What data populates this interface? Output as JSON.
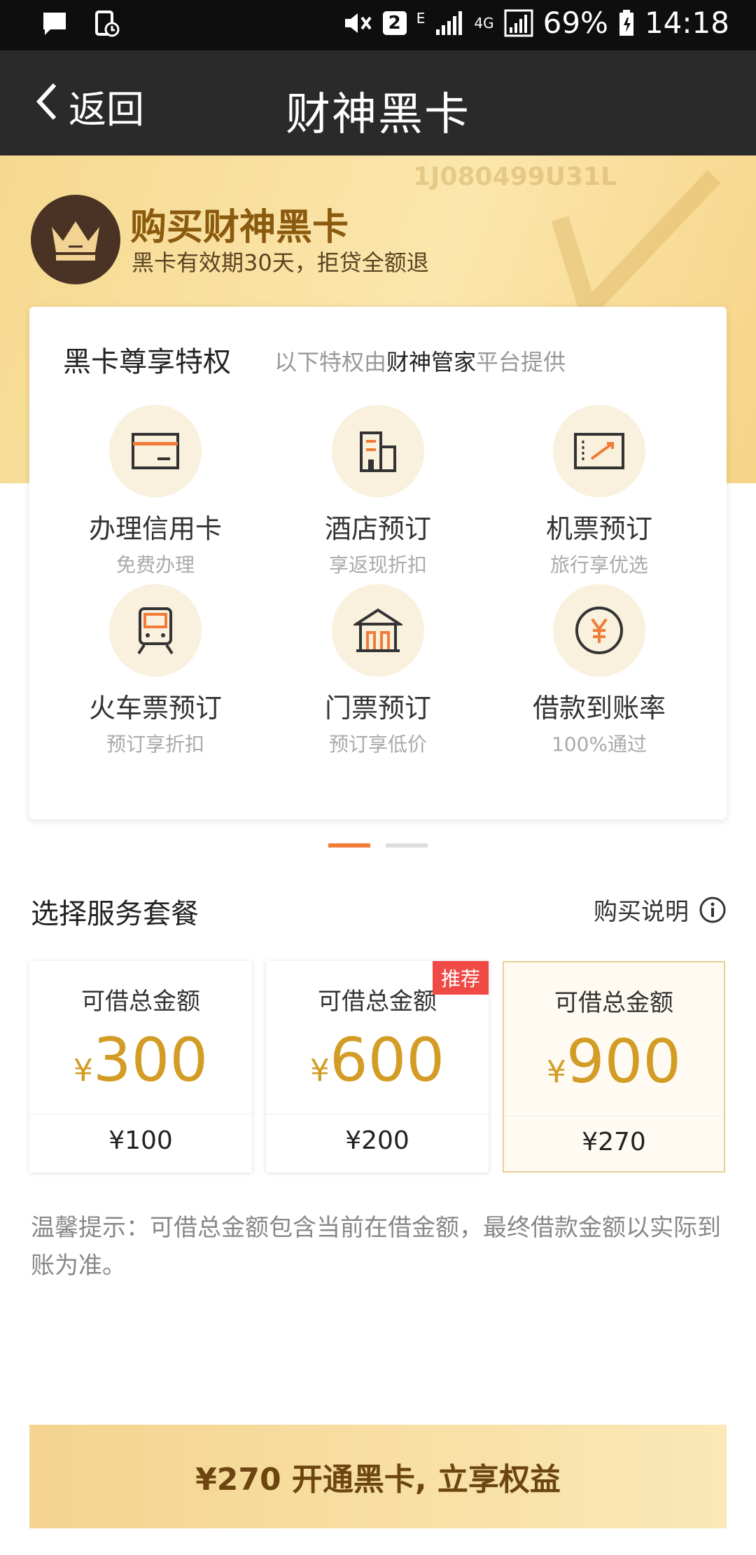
{
  "status_bar": {
    "sim_badge": "2",
    "network_e": "E",
    "network_4g": "4G",
    "battery": "69%",
    "time": "14:18"
  },
  "nav": {
    "back_label": "返回",
    "title": "财神黑卡"
  },
  "hero": {
    "watermark": "1J080499U31L",
    "title": "购买财神黑卡",
    "subtitle": "黑卡有效期30天，拒贷全额退"
  },
  "privileges": {
    "title": "黑卡尊享特权",
    "subtitle_prefix": "以下特权由",
    "subtitle_strong": "财神管家",
    "subtitle_suffix": "平台提供",
    "items": [
      {
        "name": "办理信用卡",
        "desc": "免费办理",
        "icon": "credit-card-icon"
      },
      {
        "name": "酒店预订",
        "desc": "享返现折扣",
        "icon": "hotel-icon"
      },
      {
        "name": "机票预订",
        "desc": "旅行享优选",
        "icon": "flight-ticket-icon"
      },
      {
        "name": "火车票预订",
        "desc": "预订享折扣",
        "icon": "train-icon"
      },
      {
        "name": "门票预订",
        "desc": "预订享低价",
        "icon": "gate-ticket-icon"
      },
      {
        "name": "借款到账率",
        "desc": "100%通过",
        "icon": "yuan-coin-icon"
      }
    ]
  },
  "pager": {
    "count": 2,
    "active": 0
  },
  "packages_section": {
    "title": "选择服务套餐",
    "info_label": "购买说明"
  },
  "packages": [
    {
      "label": "可借总金额",
      "currency": "¥",
      "amount": "300",
      "price": "¥100",
      "badge": "",
      "selected": false
    },
    {
      "label": "可借总金额",
      "currency": "¥",
      "amount": "600",
      "price": "¥200",
      "badge": "推荐",
      "selected": false
    },
    {
      "label": "可借总金额",
      "currency": "¥",
      "amount": "900",
      "price": "¥270",
      "badge": "",
      "selected": true
    }
  ],
  "tip": "温馨提示：可借总金额包含当前在借金额，最终借款金额以实际到账为准。",
  "cta_label": "¥270 开通黑卡, 立享权益",
  "colors": {
    "accent_gold": "#d39c25",
    "brand_dark": "#2a2a2a",
    "badge_red": "#f04a46",
    "pager_active": "#f07c38"
  }
}
